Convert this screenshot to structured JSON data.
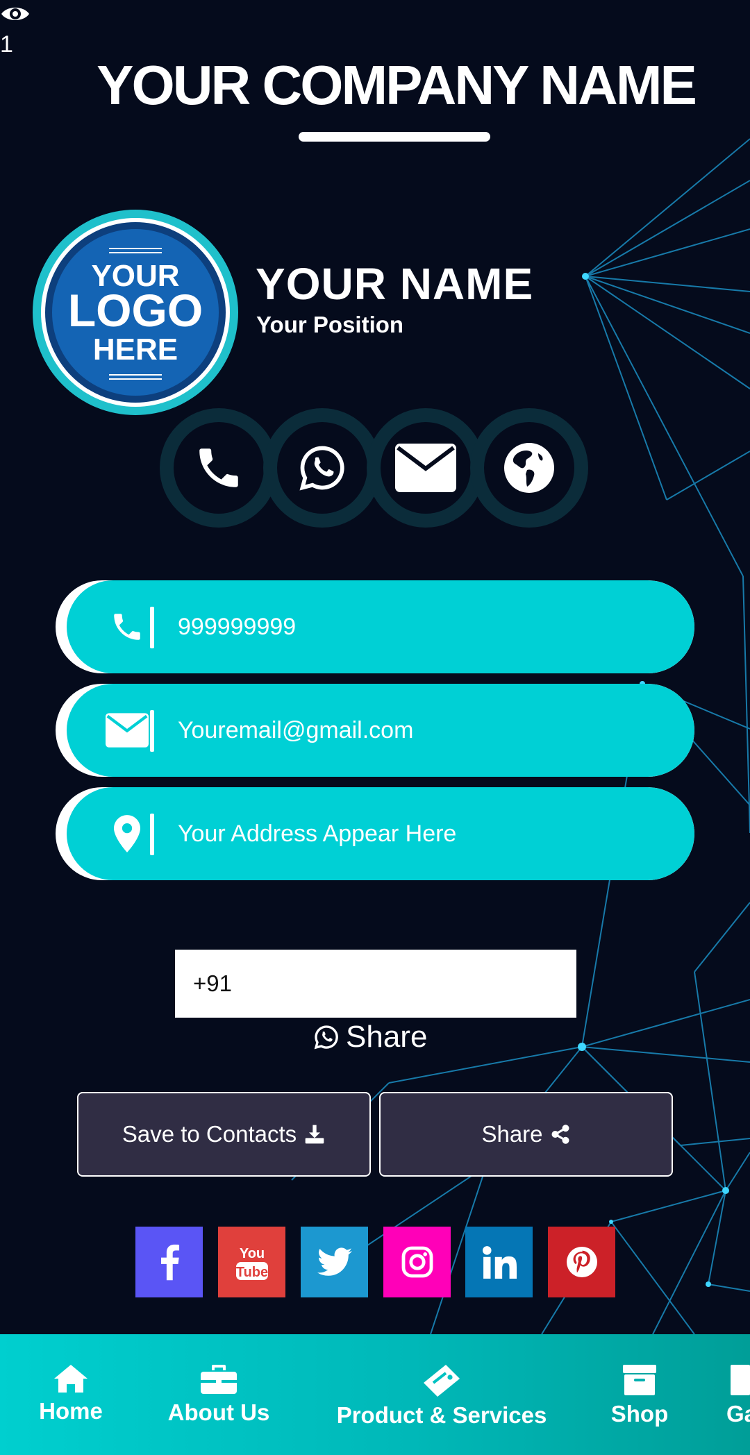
{
  "view_counter": {
    "icon": "eye-icon",
    "count": "1"
  },
  "header": {
    "company_name": "YOUR COMPANY NAME"
  },
  "logo": {
    "line1": "YOUR",
    "line2": "LOGO",
    "line3": "HERE"
  },
  "profile": {
    "name": "YOUR NAME",
    "position": "Your Position"
  },
  "quick_actions": [
    {
      "icon": "phone-icon"
    },
    {
      "icon": "whatsapp-icon"
    },
    {
      "icon": "envelope-icon"
    },
    {
      "icon": "globe-icon"
    }
  ],
  "contact_info": {
    "phone": "999999999",
    "email": "Youremail@gmail.com",
    "address": "Your Address Appear Here"
  },
  "whatsapp_share": {
    "input_value": "+91",
    "label": "Share"
  },
  "buttons": {
    "save_contacts": "Save to Contacts",
    "share": "Share"
  },
  "social": [
    {
      "name": "facebook",
      "color": "#5a55f5"
    },
    {
      "name": "youtube",
      "color": "#e0403c",
      "text1": "You",
      "text2": "Tube"
    },
    {
      "name": "twitter",
      "color": "#1c98d0"
    },
    {
      "name": "instagram",
      "color": "#ff00b8"
    },
    {
      "name": "linkedin",
      "color": "#0576b5"
    },
    {
      "name": "pinterest",
      "color": "#cc2128"
    }
  ],
  "nav": {
    "items": [
      {
        "label": "Home",
        "icon": "home-icon"
      },
      {
        "label": "About Us",
        "icon": "briefcase-icon"
      },
      {
        "label": "Product & Services",
        "icon": "tag-icon"
      },
      {
        "label": "Shop",
        "icon": "archive-box-icon"
      },
      {
        "label": "Ga",
        "icon": "gallery-icon"
      }
    ]
  },
  "colors": {
    "background": "#050b1c",
    "accent": "#00d0d5",
    "button_bg": "#302d44",
    "nav_bg": "#00c2c2"
  }
}
